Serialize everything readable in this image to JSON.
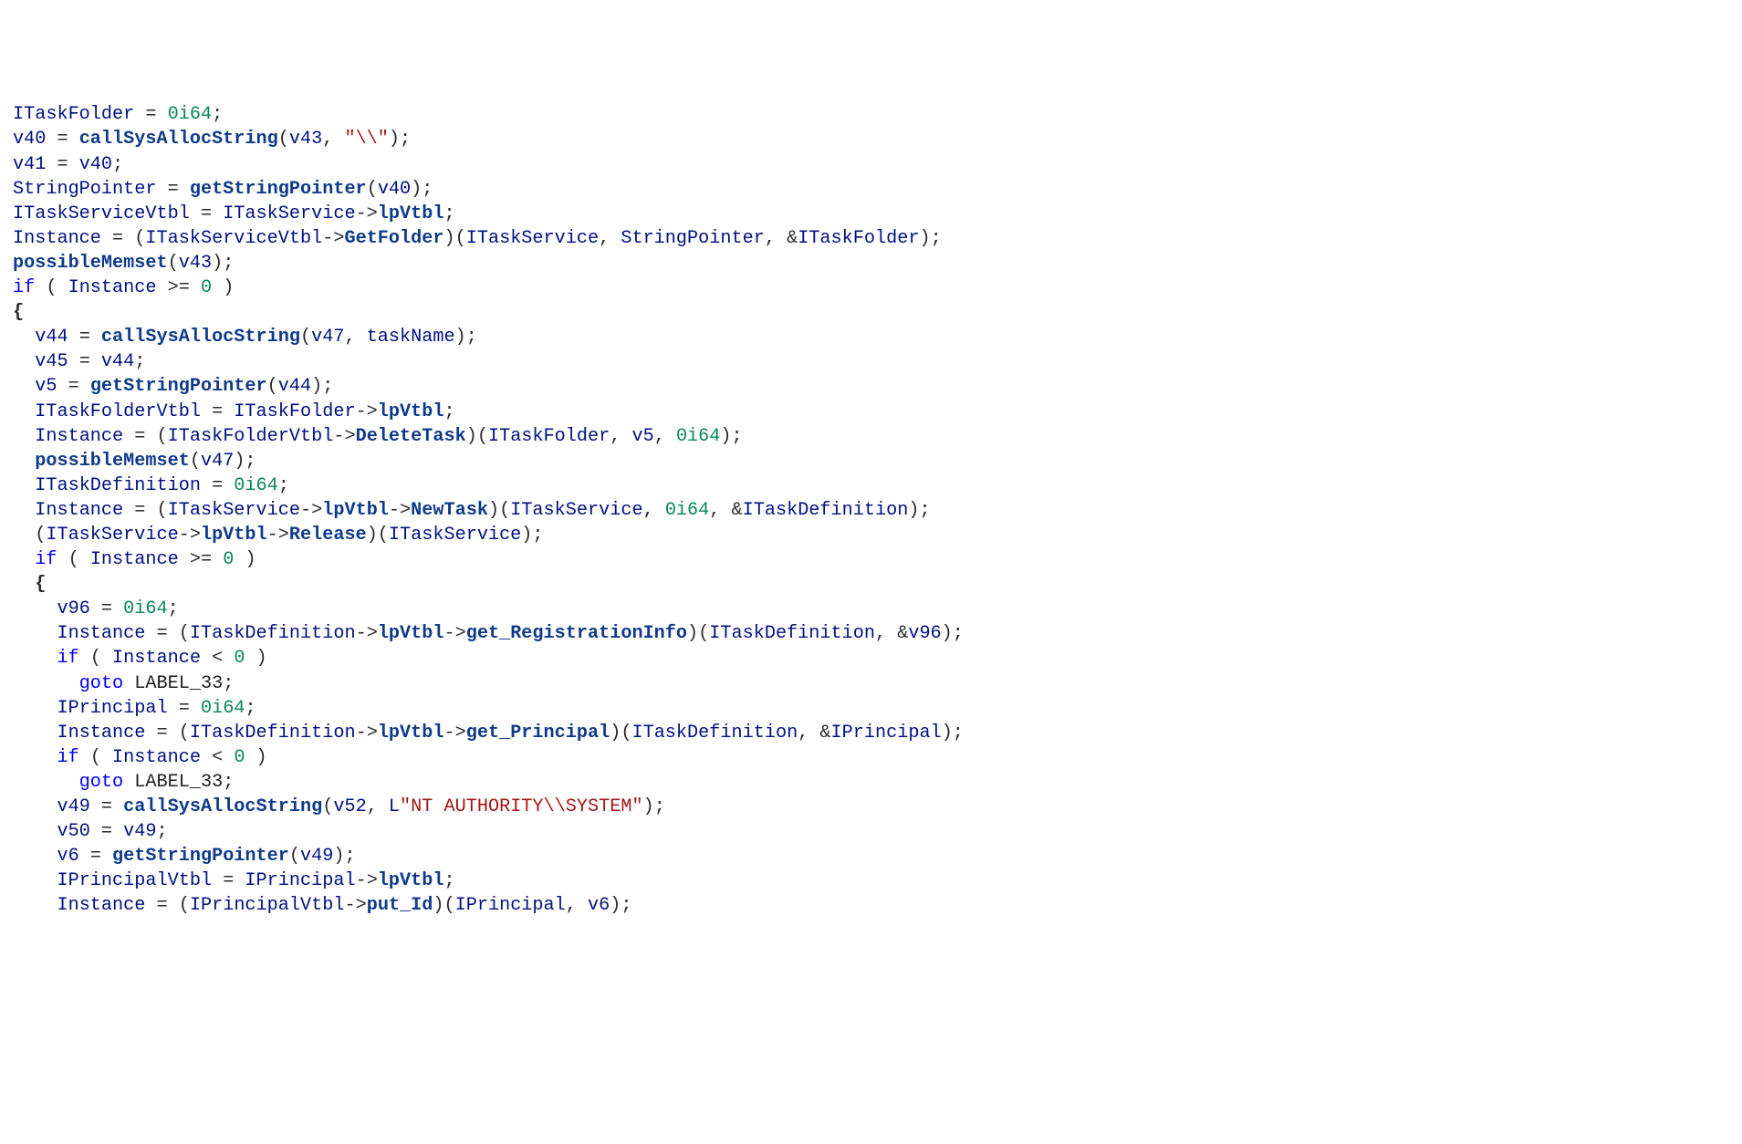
{
  "code": {
    "lines": [
      [
        {
          "t": "ITaskFolder",
          "c": "id"
        },
        {
          "t": " = ",
          "c": "pn"
        },
        {
          "t": "0i64",
          "c": "num"
        },
        {
          "t": ";",
          "c": "pn"
        }
      ],
      [
        {
          "t": "v40",
          "c": "id"
        },
        {
          "t": " = ",
          "c": "pn"
        },
        {
          "t": "callSysAllocString",
          "c": "fn"
        },
        {
          "t": "(",
          "c": "pn"
        },
        {
          "t": "v43",
          "c": "id"
        },
        {
          "t": ", ",
          "c": "pn"
        },
        {
          "t": "\"\\\\\"",
          "c": "str"
        },
        {
          "t": ");",
          "c": "pn"
        }
      ],
      [
        {
          "t": "v41",
          "c": "id"
        },
        {
          "t": " = ",
          "c": "pn"
        },
        {
          "t": "v40",
          "c": "id"
        },
        {
          "t": ";",
          "c": "pn"
        }
      ],
      [
        {
          "t": "StringPointer",
          "c": "id"
        },
        {
          "t": " = ",
          "c": "pn"
        },
        {
          "t": "getStringPointer",
          "c": "fn"
        },
        {
          "t": "(",
          "c": "pn"
        },
        {
          "t": "v40",
          "c": "id"
        },
        {
          "t": ");",
          "c": "pn"
        }
      ],
      [
        {
          "t": "ITaskServiceVtbl",
          "c": "id"
        },
        {
          "t": " = ",
          "c": "pn"
        },
        {
          "t": "ITaskService",
          "c": "id"
        },
        {
          "t": "->",
          "c": "pn"
        },
        {
          "t": "lpVtbl",
          "c": "arr"
        },
        {
          "t": ";",
          "c": "pn"
        }
      ],
      [
        {
          "t": "Instance",
          "c": "id"
        },
        {
          "t": " = (",
          "c": "pn"
        },
        {
          "t": "ITaskServiceVtbl",
          "c": "id"
        },
        {
          "t": "->",
          "c": "pn"
        },
        {
          "t": "GetFolder",
          "c": "arr"
        },
        {
          "t": ")(",
          "c": "pn"
        },
        {
          "t": "ITaskService",
          "c": "id"
        },
        {
          "t": ", ",
          "c": "pn"
        },
        {
          "t": "StringPointer",
          "c": "id"
        },
        {
          "t": ", &",
          "c": "pn"
        },
        {
          "t": "ITaskFolder",
          "c": "id"
        },
        {
          "t": ");",
          "c": "pn"
        }
      ],
      [
        {
          "t": "possibleMemset",
          "c": "fn"
        },
        {
          "t": "(",
          "c": "pn"
        },
        {
          "t": "v43",
          "c": "id"
        },
        {
          "t": ");",
          "c": "pn"
        }
      ],
      [
        {
          "t": "if",
          "c": "kw"
        },
        {
          "t": " ( ",
          "c": "pn"
        },
        {
          "t": "Instance",
          "c": "id"
        },
        {
          "t": " >= ",
          "c": "pn"
        },
        {
          "t": "0",
          "c": "num"
        },
        {
          "t": " )",
          "c": "pn"
        }
      ],
      [
        {
          "t": "{",
          "c": "br"
        }
      ],
      [
        {
          "t": "  ",
          "c": "pn"
        },
        {
          "t": "v44",
          "c": "id"
        },
        {
          "t": " = ",
          "c": "pn"
        },
        {
          "t": "callSysAllocString",
          "c": "fn"
        },
        {
          "t": "(",
          "c": "pn"
        },
        {
          "t": "v47",
          "c": "id"
        },
        {
          "t": ", ",
          "c": "pn"
        },
        {
          "t": "taskName",
          "c": "id"
        },
        {
          "t": ");",
          "c": "pn"
        }
      ],
      [
        {
          "t": "  ",
          "c": "pn"
        },
        {
          "t": "v45",
          "c": "id"
        },
        {
          "t": " = ",
          "c": "pn"
        },
        {
          "t": "v44",
          "c": "id"
        },
        {
          "t": ";",
          "c": "pn"
        }
      ],
      [
        {
          "t": "  ",
          "c": "pn"
        },
        {
          "t": "v5",
          "c": "id"
        },
        {
          "t": " = ",
          "c": "pn"
        },
        {
          "t": "getStringPointer",
          "c": "fn"
        },
        {
          "t": "(",
          "c": "pn"
        },
        {
          "t": "v44",
          "c": "id"
        },
        {
          "t": ");",
          "c": "pn"
        }
      ],
      [
        {
          "t": "  ",
          "c": "pn"
        },
        {
          "t": "ITaskFolderVtbl",
          "c": "id"
        },
        {
          "t": " = ",
          "c": "pn"
        },
        {
          "t": "ITaskFolder",
          "c": "id"
        },
        {
          "t": "->",
          "c": "pn"
        },
        {
          "t": "lpVtbl",
          "c": "arr"
        },
        {
          "t": ";",
          "c": "pn"
        }
      ],
      [
        {
          "t": "  ",
          "c": "pn"
        },
        {
          "t": "Instance",
          "c": "id"
        },
        {
          "t": " = (",
          "c": "pn"
        },
        {
          "t": "ITaskFolderVtbl",
          "c": "id"
        },
        {
          "t": "->",
          "c": "pn"
        },
        {
          "t": "DeleteTask",
          "c": "arr"
        },
        {
          "t": ")(",
          "c": "pn"
        },
        {
          "t": "ITaskFolder",
          "c": "id"
        },
        {
          "t": ", ",
          "c": "pn"
        },
        {
          "t": "v5",
          "c": "id"
        },
        {
          "t": ", ",
          "c": "pn"
        },
        {
          "t": "0i64",
          "c": "num"
        },
        {
          "t": ");",
          "c": "pn"
        }
      ],
      [
        {
          "t": "  ",
          "c": "pn"
        },
        {
          "t": "possibleMemset",
          "c": "fn"
        },
        {
          "t": "(",
          "c": "pn"
        },
        {
          "t": "v47",
          "c": "id"
        },
        {
          "t": ");",
          "c": "pn"
        }
      ],
      [
        {
          "t": "  ",
          "c": "pn"
        },
        {
          "t": "ITaskDefinition",
          "c": "id"
        },
        {
          "t": " = ",
          "c": "pn"
        },
        {
          "t": "0i64",
          "c": "num"
        },
        {
          "t": ";",
          "c": "pn"
        }
      ],
      [
        {
          "t": "  ",
          "c": "pn"
        },
        {
          "t": "Instance",
          "c": "id"
        },
        {
          "t": " = (",
          "c": "pn"
        },
        {
          "t": "ITaskService",
          "c": "id"
        },
        {
          "t": "->",
          "c": "pn"
        },
        {
          "t": "lpVtbl",
          "c": "arr"
        },
        {
          "t": "->",
          "c": "pn"
        },
        {
          "t": "NewTask",
          "c": "arr"
        },
        {
          "t": ")(",
          "c": "pn"
        },
        {
          "t": "ITaskService",
          "c": "id"
        },
        {
          "t": ", ",
          "c": "pn"
        },
        {
          "t": "0i64",
          "c": "num"
        },
        {
          "t": ", &",
          "c": "pn"
        },
        {
          "t": "ITaskDefinition",
          "c": "id"
        },
        {
          "t": ");",
          "c": "pn"
        }
      ],
      [
        {
          "t": "  (",
          "c": "pn"
        },
        {
          "t": "ITaskService",
          "c": "id"
        },
        {
          "t": "->",
          "c": "pn"
        },
        {
          "t": "lpVtbl",
          "c": "arr"
        },
        {
          "t": "->",
          "c": "pn"
        },
        {
          "t": "Release",
          "c": "arr"
        },
        {
          "t": ")(",
          "c": "pn"
        },
        {
          "t": "ITaskService",
          "c": "id"
        },
        {
          "t": ");",
          "c": "pn"
        }
      ],
      [
        {
          "t": "  ",
          "c": "pn"
        },
        {
          "t": "if",
          "c": "kw"
        },
        {
          "t": " ( ",
          "c": "pn"
        },
        {
          "t": "Instance",
          "c": "id"
        },
        {
          "t": " >= ",
          "c": "pn"
        },
        {
          "t": "0",
          "c": "num"
        },
        {
          "t": " )",
          "c": "pn"
        }
      ],
      [
        {
          "t": "  ",
          "c": "pn"
        },
        {
          "t": "{",
          "c": "br"
        }
      ],
      [
        {
          "t": "    ",
          "c": "pn"
        },
        {
          "t": "v96",
          "c": "id"
        },
        {
          "t": " = ",
          "c": "pn"
        },
        {
          "t": "0i64",
          "c": "num"
        },
        {
          "t": ";",
          "c": "pn"
        }
      ],
      [
        {
          "t": "    ",
          "c": "pn"
        },
        {
          "t": "Instance",
          "c": "id"
        },
        {
          "t": " = (",
          "c": "pn"
        },
        {
          "t": "ITaskDefinition",
          "c": "id"
        },
        {
          "t": "->",
          "c": "pn"
        },
        {
          "t": "lpVtbl",
          "c": "arr"
        },
        {
          "t": "->",
          "c": "pn"
        },
        {
          "t": "get_RegistrationInfo",
          "c": "arr"
        },
        {
          "t": ")(",
          "c": "pn"
        },
        {
          "t": "ITaskDefinition",
          "c": "id"
        },
        {
          "t": ", &",
          "c": "pn"
        },
        {
          "t": "v96",
          "c": "id"
        },
        {
          "t": ");",
          "c": "pn"
        }
      ],
      [
        {
          "t": "    ",
          "c": "pn"
        },
        {
          "t": "if",
          "c": "kw"
        },
        {
          "t": " ( ",
          "c": "pn"
        },
        {
          "t": "Instance",
          "c": "id"
        },
        {
          "t": " < ",
          "c": "pn"
        },
        {
          "t": "0",
          "c": "num"
        },
        {
          "t": " )",
          "c": "pn"
        }
      ],
      [
        {
          "t": "      ",
          "c": "pn"
        },
        {
          "t": "goto",
          "c": "kw"
        },
        {
          "t": " ",
          "c": "pn"
        },
        {
          "t": "LABEL_33",
          "c": "lbl"
        },
        {
          "t": ";",
          "c": "pn"
        }
      ],
      [
        {
          "t": "    ",
          "c": "pn"
        },
        {
          "t": "IPrincipal",
          "c": "id"
        },
        {
          "t": " = ",
          "c": "pn"
        },
        {
          "t": "0i64",
          "c": "num"
        },
        {
          "t": ";",
          "c": "pn"
        }
      ],
      [
        {
          "t": "    ",
          "c": "pn"
        },
        {
          "t": "Instance",
          "c": "id"
        },
        {
          "t": " = (",
          "c": "pn"
        },
        {
          "t": "ITaskDefinition",
          "c": "id"
        },
        {
          "t": "->",
          "c": "pn"
        },
        {
          "t": "lpVtbl",
          "c": "arr"
        },
        {
          "t": "->",
          "c": "pn"
        },
        {
          "t": "get_Principal",
          "c": "arr"
        },
        {
          "t": ")(",
          "c": "pn"
        },
        {
          "t": "ITaskDefinition",
          "c": "id"
        },
        {
          "t": ", &",
          "c": "pn"
        },
        {
          "t": "IPrincipal",
          "c": "id"
        },
        {
          "t": ");",
          "c": "pn"
        }
      ],
      [
        {
          "t": "    ",
          "c": "pn"
        },
        {
          "t": "if",
          "c": "kw"
        },
        {
          "t": " ( ",
          "c": "pn"
        },
        {
          "t": "Instance",
          "c": "id"
        },
        {
          "t": " < ",
          "c": "pn"
        },
        {
          "t": "0",
          "c": "num"
        },
        {
          "t": " )",
          "c": "pn"
        }
      ],
      [
        {
          "t": "      ",
          "c": "pn"
        },
        {
          "t": "goto",
          "c": "kw"
        },
        {
          "t": " ",
          "c": "pn"
        },
        {
          "t": "LABEL_33",
          "c": "lbl"
        },
        {
          "t": ";",
          "c": "pn"
        }
      ],
      [
        {
          "t": "    ",
          "c": "pn"
        },
        {
          "t": "v49",
          "c": "id"
        },
        {
          "t": " = ",
          "c": "pn"
        },
        {
          "t": "callSysAllocString",
          "c": "fn"
        },
        {
          "t": "(",
          "c": "pn"
        },
        {
          "t": "v52",
          "c": "id"
        },
        {
          "t": ", ",
          "c": "pn"
        },
        {
          "t": "L",
          "c": "id"
        },
        {
          "t": "\"NT AUTHORITY\\\\SYSTEM\"",
          "c": "str"
        },
        {
          "t": ");",
          "c": "pn"
        }
      ],
      [
        {
          "t": "    ",
          "c": "pn"
        },
        {
          "t": "v50",
          "c": "id"
        },
        {
          "t": " = ",
          "c": "pn"
        },
        {
          "t": "v49",
          "c": "id"
        },
        {
          "t": ";",
          "c": "pn"
        }
      ],
      [
        {
          "t": "    ",
          "c": "pn"
        },
        {
          "t": "v6",
          "c": "id"
        },
        {
          "t": " = ",
          "c": "pn"
        },
        {
          "t": "getStringPointer",
          "c": "fn"
        },
        {
          "t": "(",
          "c": "pn"
        },
        {
          "t": "v49",
          "c": "id"
        },
        {
          "t": ");",
          "c": "pn"
        }
      ],
      [
        {
          "t": "    ",
          "c": "pn"
        },
        {
          "t": "IPrincipalVtbl",
          "c": "id"
        },
        {
          "t": " = ",
          "c": "pn"
        },
        {
          "t": "IPrincipal",
          "c": "id"
        },
        {
          "t": "->",
          "c": "pn"
        },
        {
          "t": "lpVtbl",
          "c": "arr"
        },
        {
          "t": ";",
          "c": "pn"
        }
      ],
      [
        {
          "t": "    ",
          "c": "pn"
        },
        {
          "t": "Instance",
          "c": "id"
        },
        {
          "t": " = (",
          "c": "pn"
        },
        {
          "t": "IPrincipalVtbl",
          "c": "id"
        },
        {
          "t": "->",
          "c": "pn"
        },
        {
          "t": "put_Id",
          "c": "arr"
        },
        {
          "t": ")(",
          "c": "pn"
        },
        {
          "t": "IPrincipal",
          "c": "id"
        },
        {
          "t": ", ",
          "c": "pn"
        },
        {
          "t": "v6",
          "c": "id"
        },
        {
          "t": ");",
          "c": "pn"
        }
      ]
    ]
  }
}
